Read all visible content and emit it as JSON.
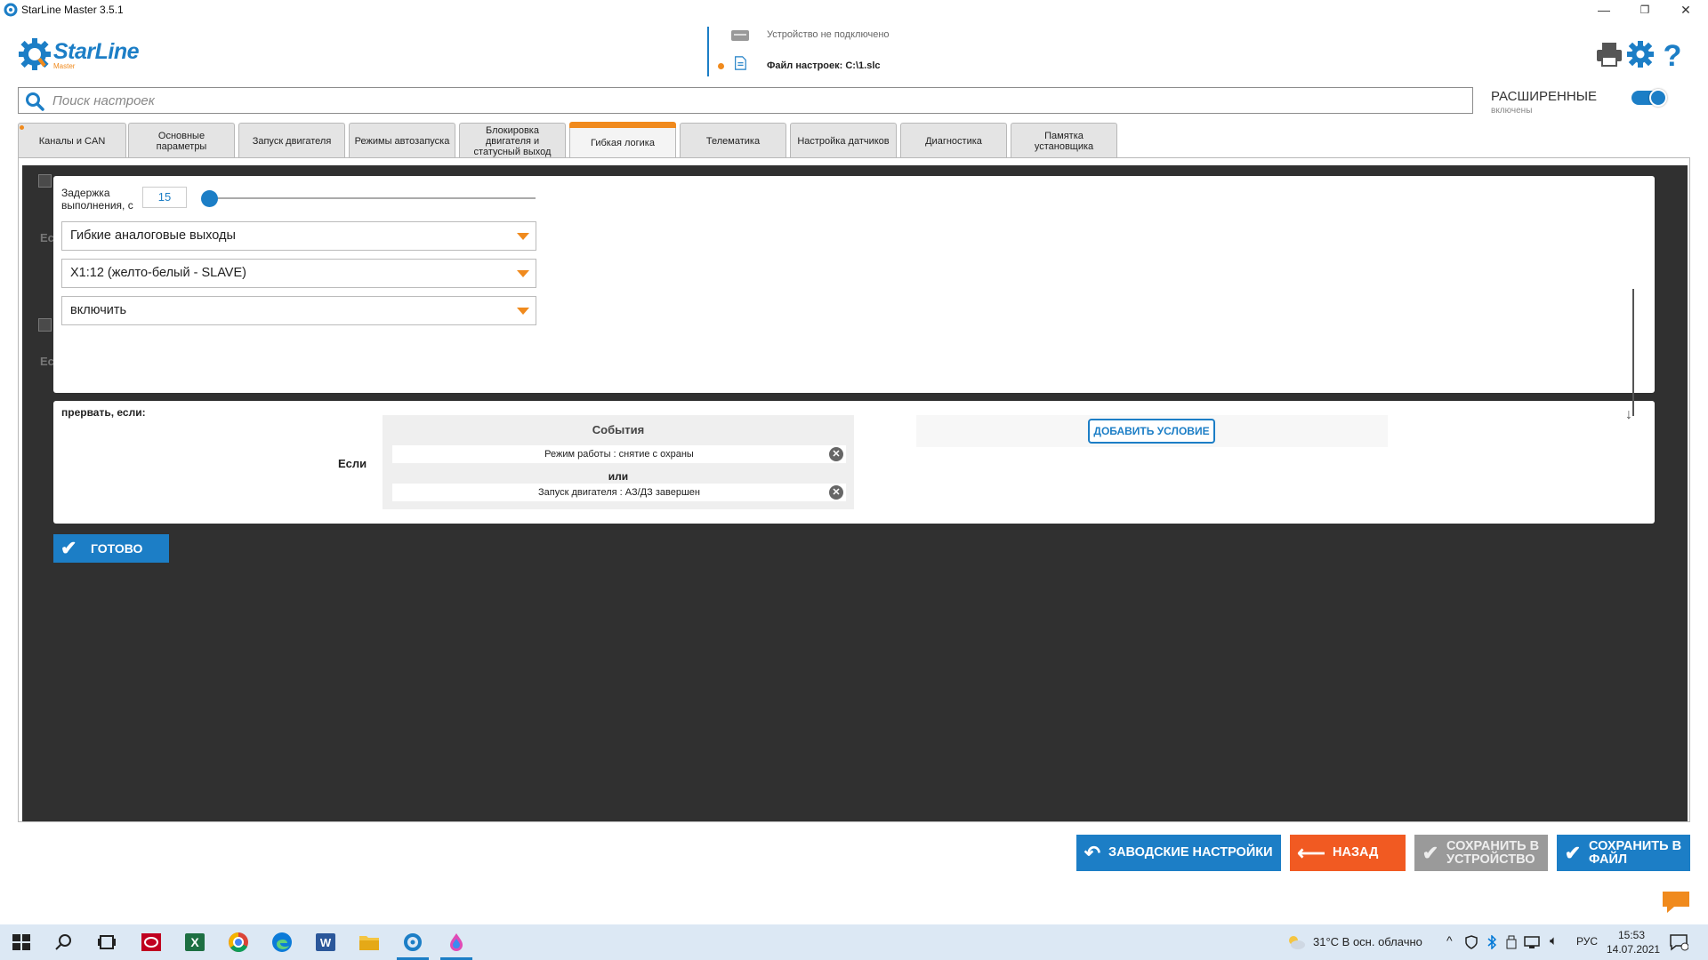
{
  "window": {
    "title": "StarLine Master 3.5.1",
    "minimize": "—",
    "maximize": "❐",
    "close": "✕"
  },
  "logo": {
    "brand": "StarLine",
    "sub": "Master"
  },
  "status": {
    "device": "Устройство не подключено",
    "file": "Файл настроек: C:\\1.slc"
  },
  "search": {
    "placeholder": "Поиск настроек",
    "value": ""
  },
  "advanced": {
    "label": "РАСШИРЕННЫЕ",
    "sub": "включены",
    "enabled": true
  },
  "tabs": [
    {
      "label": "Каналы и CAN"
    },
    {
      "label": "Основные параметры"
    },
    {
      "label": "Запуск двигателя"
    },
    {
      "label": "Режимы автозапуска"
    },
    {
      "label": "Блокировка двигателя и статусный выход"
    },
    {
      "label": "Гибкая логика",
      "active": true
    },
    {
      "label": "Телематика"
    },
    {
      "label": "Настройка датчиков"
    },
    {
      "label": "Диагностика"
    },
    {
      "label": "Памятка установщика"
    }
  ],
  "background_ghost": {
    "text1": "Ес",
    "text2": "Ес"
  },
  "action": {
    "delay_label": "Задержка выполнения, с",
    "delay_value": "15",
    "delay_level_fraction": 0.0,
    "output_type": "Гибкие аналоговые выходы",
    "output_channel": "X1:12 (желто-белый - SLAVE)",
    "output_action": "включить"
  },
  "interrupt": {
    "label": "прервать, если:",
    "if_label": "Если",
    "events_title": "События",
    "events": [
      "Режим работы : снятие с охраны",
      "Запуск двигателя : АЗ/ДЗ завершен"
    ],
    "or_label": "или",
    "remove_glyph": "✕",
    "add_condition": "ДОБАВИТЬ УСЛОВИЕ"
  },
  "done_button": "ГОТОВО",
  "buttons": {
    "factory": "ЗАВОДСКИЕ НАСТРОЙКИ",
    "back": "НАЗАД",
    "save_device_1": "СОХРАНИТЬ В",
    "save_device_2": "УСТРОЙСТВО",
    "save_file_1": "СОХРАНИТЬ В",
    "save_file_2": "ФАЙЛ"
  },
  "taskbar": {
    "weather": "31°C  В осн. облачно",
    "lang": "РУС",
    "time": "15:53",
    "date": "14.07.2021"
  },
  "colors": {
    "accent": "#1c7ec6",
    "orange": "#f08a1d",
    "back_button": "#f15a22",
    "dark_bg": "#303030"
  }
}
